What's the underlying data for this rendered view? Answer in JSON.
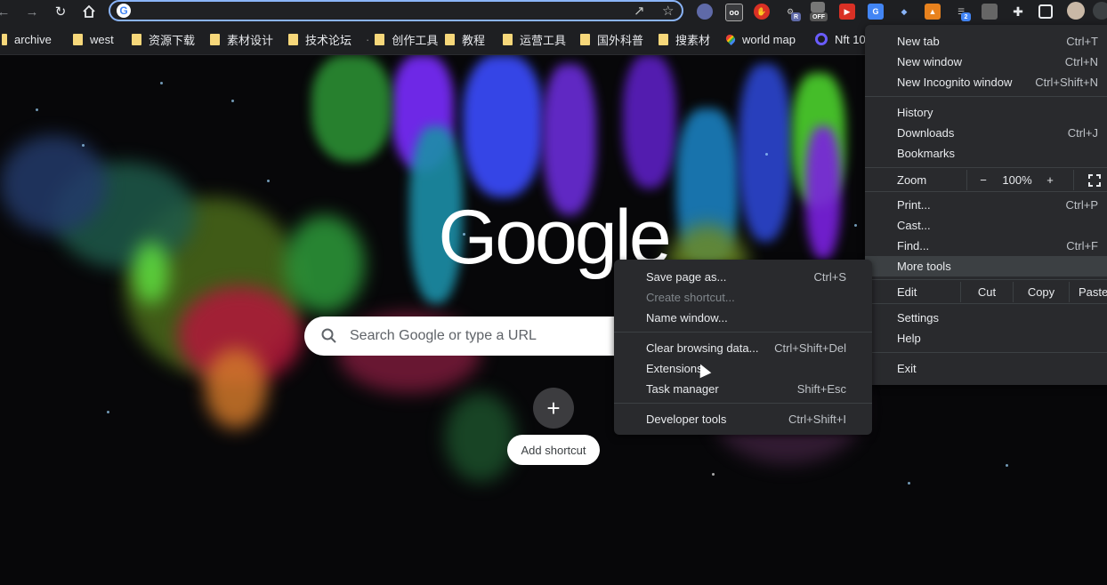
{
  "toolbar": {
    "back_icon": "arrow-left-icon",
    "forward_icon": "arrow-right-icon",
    "reload_icon": "reload-icon",
    "home_icon": "home-icon",
    "omnibox_value": "",
    "ext_badge_r": "R",
    "ext_badge_off": "OFF",
    "ext_badge_2": "2"
  },
  "bookmarks": [
    {
      "label": "archive"
    },
    {
      "label": "west"
    },
    {
      "label": "资源下载"
    },
    {
      "label": "素材设计"
    },
    {
      "label": "技术论坛"
    },
    {
      "label": "创作工具"
    },
    {
      "label": "教程"
    },
    {
      "label": "运营工具"
    },
    {
      "label": "国外科普"
    },
    {
      "label": "搜素材"
    },
    {
      "label": "world map"
    },
    {
      "label": "Nft 10"
    }
  ],
  "ntp": {
    "logo_text": "Google",
    "search_placeholder": "Search Google or type a URL",
    "add_shortcut_symbol": "+",
    "add_shortcut_label": "Add shortcut"
  },
  "main_menu": {
    "new_tab": {
      "label": "New tab",
      "shortcut": "Ctrl+T"
    },
    "new_window": {
      "label": "New window",
      "shortcut": "Ctrl+N"
    },
    "new_incognito": {
      "label": "New Incognito window",
      "shortcut": "Ctrl+Shift+N"
    },
    "history": {
      "label": "History"
    },
    "downloads": {
      "label": "Downloads",
      "shortcut": "Ctrl+J"
    },
    "bookmarks": {
      "label": "Bookmarks"
    },
    "zoom": {
      "label": "Zoom",
      "minus": "−",
      "value": "100%",
      "plus": "+"
    },
    "print": {
      "label": "Print...",
      "shortcut": "Ctrl+P"
    },
    "cast": {
      "label": "Cast..."
    },
    "find": {
      "label": "Find...",
      "shortcut": "Ctrl+F"
    },
    "more_tools": {
      "label": "More tools"
    },
    "edit": {
      "label": "Edit",
      "cut": "Cut",
      "copy": "Copy",
      "paste": "Paste"
    },
    "settings": {
      "label": "Settings"
    },
    "help": {
      "label": "Help"
    },
    "exit": {
      "label": "Exit"
    }
  },
  "sub_menu": {
    "save_page": {
      "label": "Save page as...",
      "shortcut": "Ctrl+S"
    },
    "create_shortcut": {
      "label": "Create shortcut..."
    },
    "name_window": {
      "label": "Name window..."
    },
    "clear_data": {
      "label": "Clear browsing data...",
      "shortcut": "Ctrl+Shift+Del"
    },
    "extensions": {
      "label": "Extensions"
    },
    "task_manager": {
      "label": "Task manager",
      "shortcut": "Shift+Esc"
    },
    "dev_tools": {
      "label": "Developer tools",
      "shortcut": "Ctrl+Shift+I"
    }
  },
  "colors": {
    "accent": "#8ab4f8",
    "menu_bg": "#292a2d",
    "menu_highlight": "#3c4043"
  }
}
